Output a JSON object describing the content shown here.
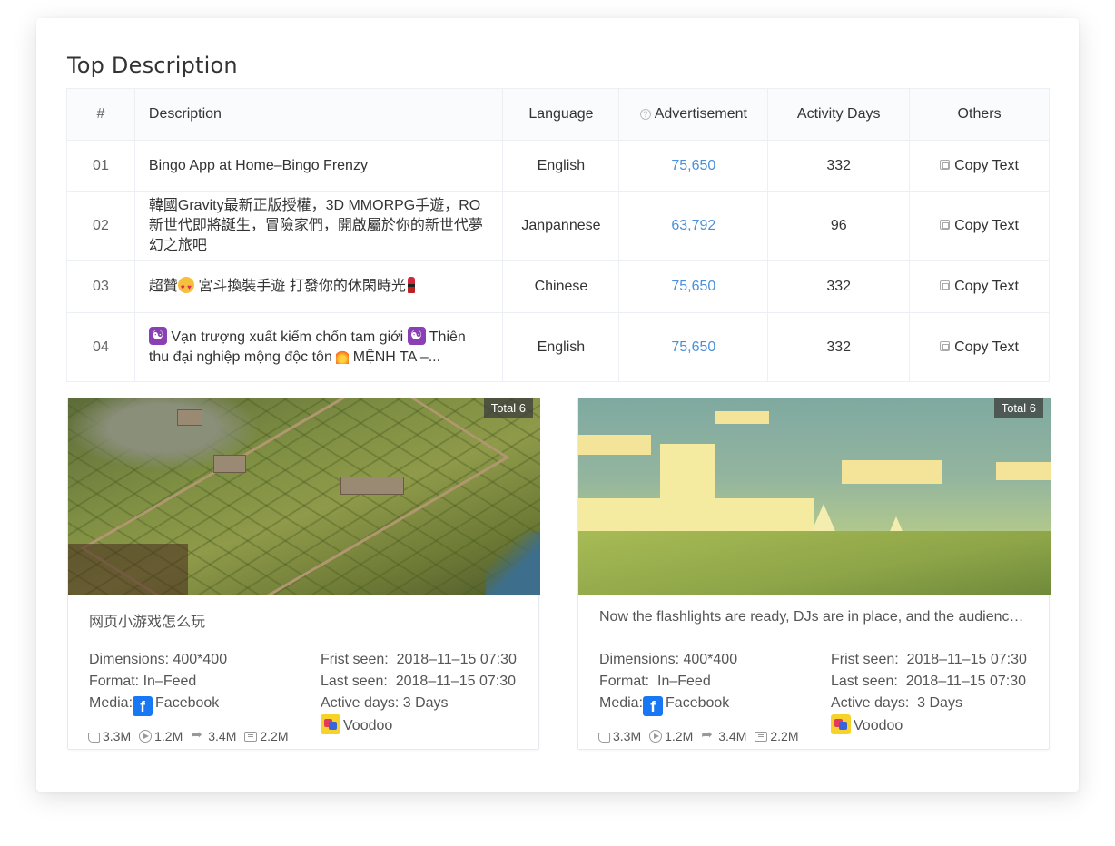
{
  "section_title": "Top Description",
  "table": {
    "headers": {
      "num": "#",
      "description": "Description",
      "language": "Language",
      "advertisement": "Advertisement",
      "activity_days": "Activity Days",
      "others": "Others"
    },
    "rows": [
      {
        "num": "01",
        "description": "Bingo App at Home–Bingo Frenzy",
        "language": "English",
        "advertisement": "75,650",
        "activity_days": "332",
        "action": "Copy Text"
      },
      {
        "num": "02",
        "description": "韓國Gravity最新正版授權，3D MMORPG手遊，RO新世代即將誕生，冒險家們，開啟屬於你的新世代夢幻之旅吧",
        "language": "Janpannese",
        "advertisement": "63,792",
        "activity_days": "96",
        "action": "Copy Text"
      },
      {
        "num": "03",
        "description_before": "超贊",
        "description_after": "宮斗換裝手遊 打發你的休閑時光",
        "language": "Chinese",
        "advertisement": "75,650",
        "activity_days": "332",
        "action": "Copy Text"
      },
      {
        "num": "04",
        "description_a": "Vạn trượng xuất kiếm chốn tam giới",
        "description_b": "Thiên thu đại nghiệp mộng độc tôn",
        "description_c": "MỆNH TA –...",
        "language": "English",
        "advertisement": "75,650",
        "activity_days": "332",
        "action": "Copy Text"
      }
    ]
  },
  "cards": [
    {
      "badge": "Total 6",
      "title": "网页小游戏怎么玩",
      "dimensions_label": "Dimensions:",
      "dimensions": "400*400",
      "format_label": "Format:",
      "format": "In–Feed",
      "media_label": "Media:",
      "media": "Facebook",
      "first_seen_label": "Frist seen:",
      "first_seen": "2018–11–15 07:30",
      "last_seen_label": "Last seen:",
      "last_seen": "2018–11–15 07:30",
      "active_days_label": "Active days:",
      "active_days": "3 Days",
      "advertiser": "Voodoo",
      "likes": "3.3M",
      "plays": "1.2M",
      "shares": "3.4M",
      "comments": "2.2M"
    },
    {
      "badge": "Total 6",
      "title": "Now the flashlights are ready, DJs are in place, and the audience is waiting for the show to begin",
      "dimensions_label": "Dimensions:",
      "dimensions": "400*400",
      "format_label": "Format:",
      "format": "In–Feed",
      "media_label": "Media:",
      "media": "Facebook",
      "first_seen_label": "Frist seen:",
      "first_seen": "2018–11–15 07:30",
      "last_seen_label": "Last seen:",
      "last_seen": "2018–11–15 07:30",
      "active_days_label": "Active days:",
      "active_days": "3 Days",
      "advertiser": "Voodoo",
      "likes": "3.3M",
      "plays": "1.2M",
      "shares": "3.4M",
      "comments": "2.2M"
    }
  ],
  "colors": {
    "accent_link": "#4a90d9",
    "facebook": "#1877f2",
    "border": "#e6e9ee"
  }
}
